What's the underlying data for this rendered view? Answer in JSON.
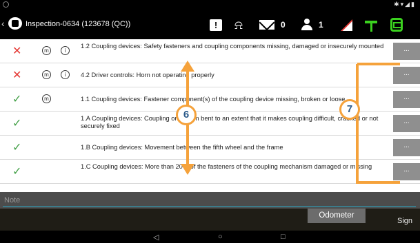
{
  "header": {
    "title": "Inspection-0634 (123678 (QC))",
    "mail_count": "0",
    "user_count": "1",
    "icons": [
      "back-icon",
      "logo-icon",
      "alert-icon",
      "bell-icon",
      "mail-icon",
      "person-icon",
      "flag-icon",
      "sign-icon",
      "bus-icon"
    ]
  },
  "rows": [
    {
      "status": "fail",
      "text": "1.2 Coupling devices: Safety fasteners and coupling components missing, damaged or insecurely mounted",
      "more": "..."
    },
    {
      "status": "fail",
      "text": "4.2 Driver controls: Horn not operating properly",
      "more": "..."
    },
    {
      "status": "pass",
      "text": "1.1 Coupling devices: Fastener component(s) of the coupling device missing, broken or loose",
      "more": "..."
    },
    {
      "status": "pass",
      "text": "1.A Coupling devices: Coupling or kingpin bent to an extent that it makes coupling difficult, cracked or not securely fixed",
      "more": "..."
    },
    {
      "status": "pass",
      "text": "1.B Coupling devices: Movement between the fifth wheel and the frame",
      "more": "..."
    },
    {
      "status": "pass",
      "text": "1.C Coupling devices: More than 20% of the fasteners of the coupling mechanism damaged or missing",
      "more": "..."
    }
  ],
  "badges": {
    "m": "m",
    "i": "i"
  },
  "note": {
    "placeholder": "Note"
  },
  "bottom": {
    "odometer": "Odometer",
    "sign": "Sign"
  },
  "nav": {
    "back": "◁",
    "home": "○",
    "recents": "□"
  },
  "callouts": {
    "six": "6",
    "seven": "7"
  },
  "colors": {
    "accent": "#f5a23b",
    "pass": "#43a047",
    "fail": "#e53935",
    "green_icon": "#3bd11f"
  }
}
